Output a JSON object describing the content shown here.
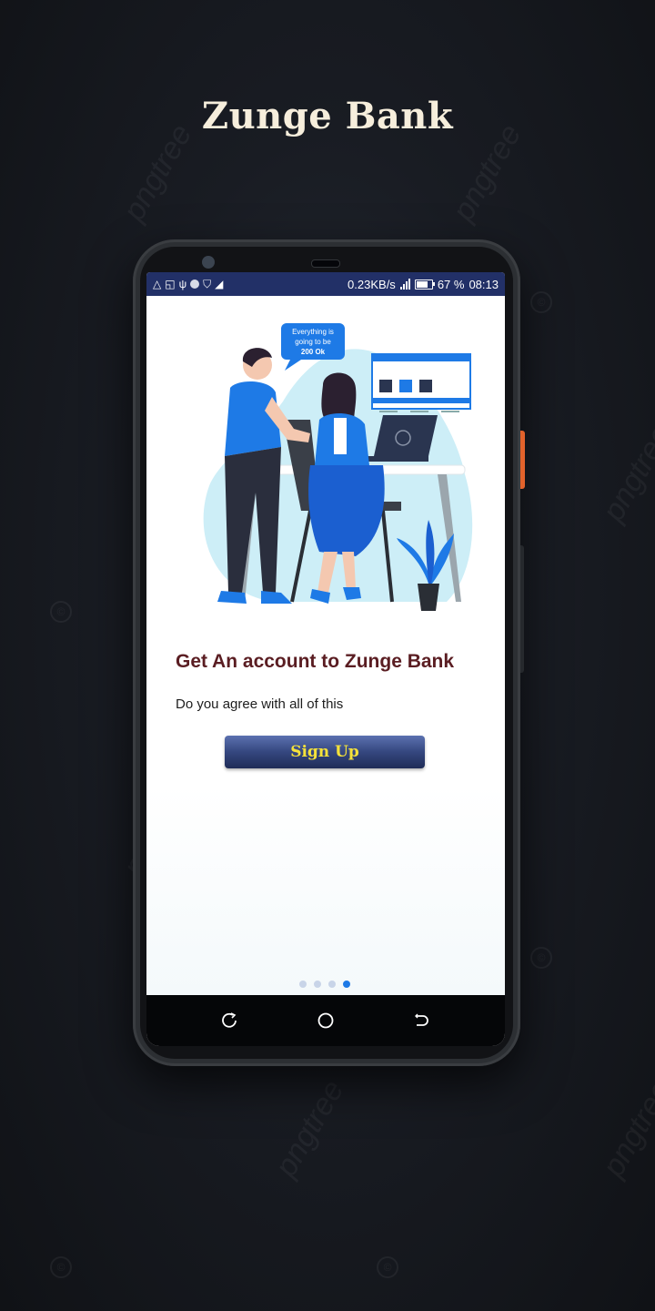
{
  "app": {
    "brand_title": "Zunge Bank"
  },
  "statusbar": {
    "network_speed": "0.23KB/s",
    "battery_percent": "67 %",
    "time": "08:13",
    "left_icons": [
      "warning-triangle-icon",
      "screen-cast-icon",
      "usb-icon",
      "circle-icon",
      "shield-icon",
      "telegram-icon"
    ]
  },
  "illustration": {
    "bubble_line1": "Everything is",
    "bubble_line2": "going to be",
    "bubble_line3": "200 Ok"
  },
  "onboarding": {
    "title": "Get An account to Zunge Bank",
    "subtitle": "Do you agree with all of this",
    "signup_label": "Sign Up",
    "page_count": 4,
    "active_page": 4
  },
  "watermark": {
    "text": "pngtree"
  },
  "colors": {
    "statusbar": "#223067",
    "title": "#5a1d22",
    "button_text": "#f5e23a",
    "accent_blue": "#1e7ae6"
  }
}
